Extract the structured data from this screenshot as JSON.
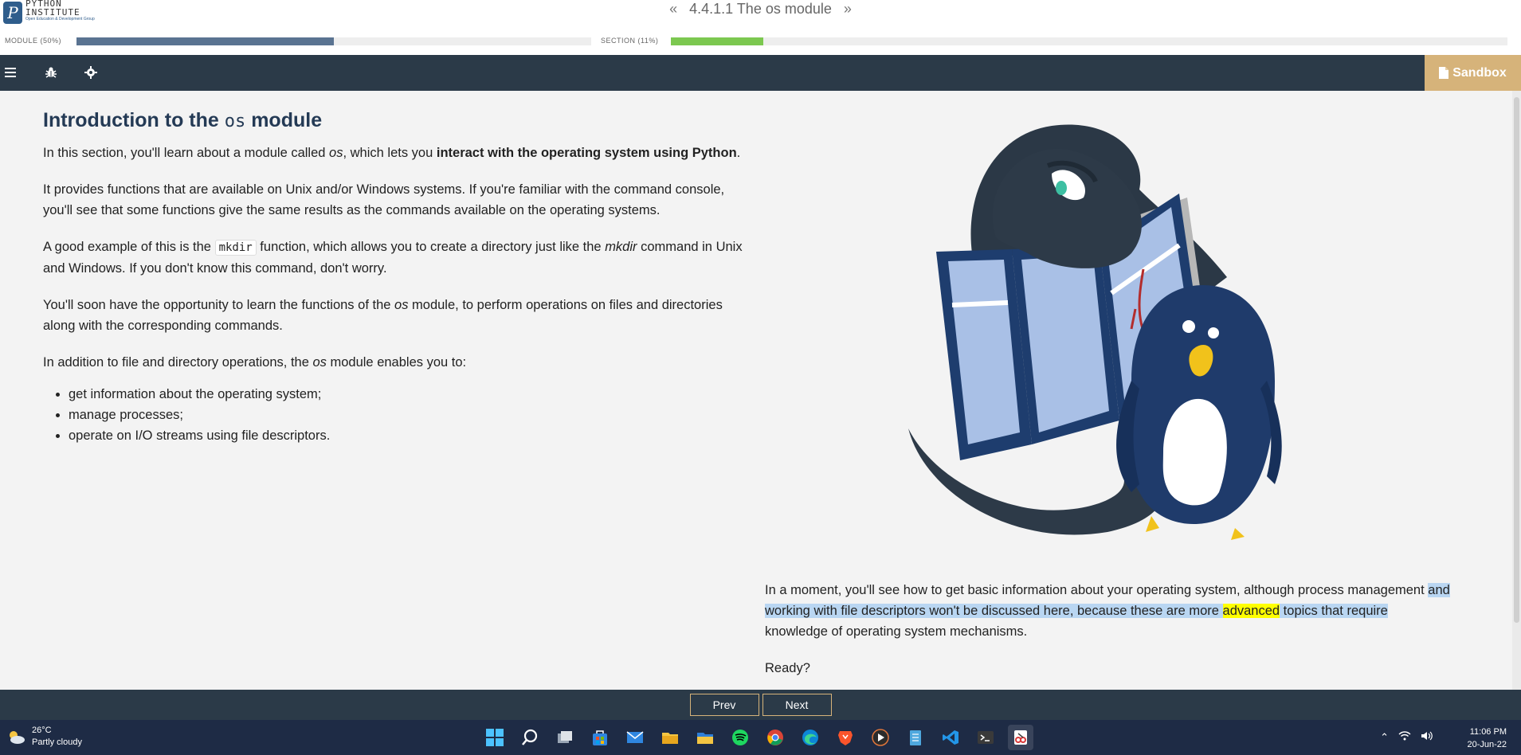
{
  "header": {
    "logo": {
      "line1": "PYTHON",
      "line2": "INSTITUTE",
      "line3": "Open Education & Development Group",
      "letter": "P"
    },
    "breadcrumb": {
      "prev": "«",
      "title": "4.4.1.1 The os module",
      "next": "»"
    },
    "module_progress": {
      "label": "MODULE (50%)",
      "fraction": 0.5,
      "color": "#5a7391"
    },
    "section_progress": {
      "label": "SECTION (11%)",
      "fraction": 0.11,
      "color": "#7cc850"
    }
  },
  "toolbar": {
    "menu_icon": "hamburger-icon",
    "bug_icon": "bug-icon",
    "settings_icon": "gear-icon",
    "sandbox_label": "Sandbox"
  },
  "content": {
    "heading_pre": "Introduction to the",
    "heading_code": "os",
    "heading_post": "module",
    "p1_a": "In this section, you'll learn about a module called ",
    "p1_em": "os",
    "p1_b": ", which lets you ",
    "p1_strong": "interact with the operating system using Python",
    "p1_c": ".",
    "p2": "It provides functions that are available on Unix and/or Windows systems. If you're familiar with the command console, you'll see that some functions give the same results as the commands available on the operating systems.",
    "p3_a": "A good example of this is the ",
    "p3_code": "mkdir",
    "p3_b": " function, which allows you to create a directory just like the ",
    "p3_em": "mkdir",
    "p3_c": " command in Unix and Windows. If you don't know this command, don't worry.",
    "p4_a": "You'll soon have the opportunity to learn the functions of the ",
    "p4_em": "os",
    "p4_b": " module, to perform operations on files and directories along with the corresponding commands.",
    "p5_a": "In addition to file and directory operations, the ",
    "p5_em": "os",
    "p5_b": " module enables you to:",
    "list": [
      "get information about the operating system;",
      "manage processes;",
      "operate on I/O streams using file descriptors."
    ],
    "r1_a": "In a moment, you'll see how to get basic information about your operating system, although process management ",
    "r1_sel_a": "and working with file descriptors won't be discussed here, because these are more ",
    "r1_yellow": "advanced",
    "r1_sel_b": " topics that require",
    "r1_b": " knowledge of operating system mechanisms.",
    "r2": "Ready?"
  },
  "footer": {
    "prev_label": "Prev",
    "next_label": "Next"
  },
  "taskbar": {
    "weather_temp": "26°C",
    "weather_desc": "Partly cloudy",
    "time": "11:06 PM",
    "date": "20-Jun-22",
    "apps": [
      "windows-start-icon",
      "search-icon",
      "task-view-icon",
      "store-icon",
      "mail-icon",
      "file-explorer-icon",
      "folder-icon",
      "spotify-icon",
      "chrome-icon",
      "edge-icon",
      "brave-icon",
      "media-player-icon",
      "notepad-icon",
      "vscode-icon",
      "terminal-icon",
      "snipping-tool-icon"
    ]
  }
}
